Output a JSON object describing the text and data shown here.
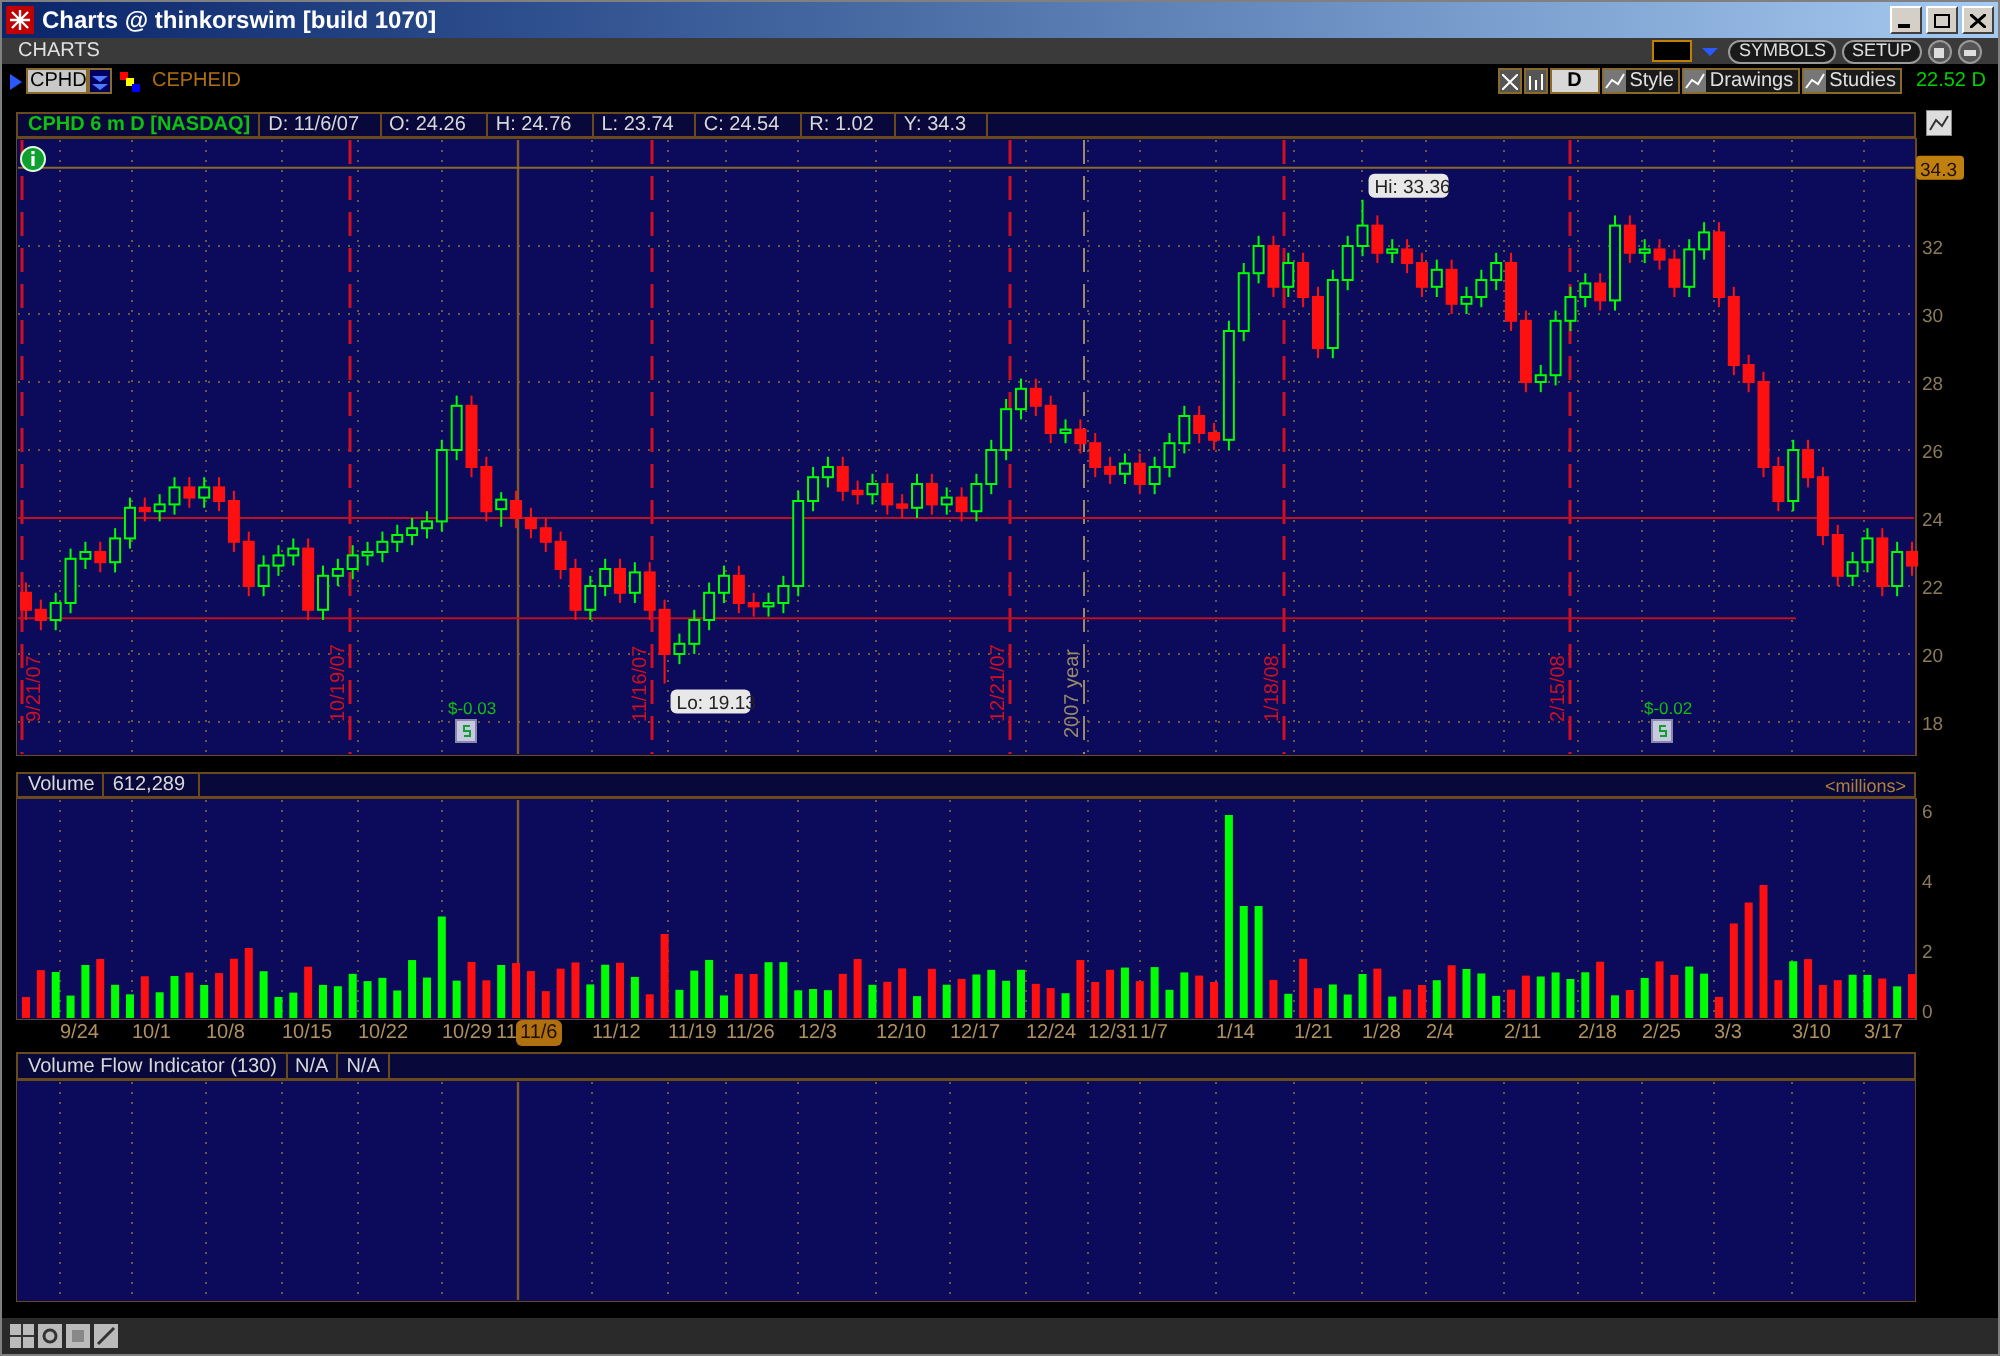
{
  "window": {
    "title": "Charts @ thinkorswim [build 1070]"
  },
  "section": {
    "title": "CHARTS"
  },
  "header_buttons": [
    "SYMBOLS",
    "SETUP"
  ],
  "symbol_bar": {
    "symbol": "CPHD",
    "company": "CEPHEID"
  },
  "chart_toolbar": {
    "aggregation": "D",
    "buttons": [
      "Style",
      "Drawings",
      "Studies"
    ],
    "last_price": "22.52 D"
  },
  "price_panel": {
    "title": "CPHD 6 m D [NASDAQ]",
    "fields": [
      "D: 11/6/07",
      "O: 24.26",
      "H: 24.76",
      "L: 23.74",
      "C: 24.54",
      "R: 1.02",
      "Y: 34.3"
    ],
    "price_marker": "34.3",
    "high_label": "Hi: 33.36",
    "low_label": "Lo: 19.13",
    "date_markers": [
      {
        "label": "9/21/07",
        "kind": "month"
      },
      {
        "label": "10/19/07",
        "kind": "month"
      },
      {
        "label": "11/16/07",
        "kind": "month"
      },
      {
        "label": "12/21/07",
        "kind": "month"
      },
      {
        "label": "2007 year",
        "kind": "year"
      },
      {
        "label": "1/18/08",
        "kind": "month"
      },
      {
        "label": "2/15/08",
        "kind": "month"
      }
    ],
    "dividends": [
      "$-0.03",
      "$-0.02"
    ],
    "chart_data": {
      "type": "candlestick",
      "grid": true,
      "ylim": [
        17,
        35
      ],
      "yticks": [
        32,
        30,
        28,
        26,
        24,
        22,
        20,
        18
      ],
      "ref_lines": [
        {
          "axis": "y",
          "value": 34.3,
          "color": "#8a6a2a"
        },
        {
          "axis": "y",
          "value": 24,
          "color": "#c01020"
        },
        {
          "axis": "y",
          "value": 21.05,
          "color": "#c01020"
        }
      ],
      "ohlc": [
        [
          21.8,
          22.1,
          21.0,
          21.3
        ],
        [
          21.3,
          21.6,
          20.7,
          21.0
        ],
        [
          21.0,
          21.8,
          20.7,
          21.5
        ],
        [
          21.5,
          23.1,
          21.2,
          22.8
        ],
        [
          22.8,
          23.3,
          22.5,
          23.0
        ],
        [
          23.0,
          23.3,
          22.4,
          22.7
        ],
        [
          22.7,
          23.7,
          22.4,
          23.4
        ],
        [
          23.4,
          24.6,
          23.1,
          24.3
        ],
        [
          24.3,
          24.6,
          23.9,
          24.2
        ],
        [
          24.2,
          24.7,
          23.9,
          24.4
        ],
        [
          24.4,
          25.2,
          24.1,
          24.9
        ],
        [
          24.9,
          25.2,
          24.3,
          24.6
        ],
        [
          24.6,
          25.2,
          24.3,
          24.9
        ],
        [
          24.9,
          25.2,
          24.2,
          24.5
        ],
        [
          24.5,
          24.8,
          23.0,
          23.3
        ],
        [
          23.3,
          23.6,
          21.7,
          22.0
        ],
        [
          22.0,
          22.9,
          21.7,
          22.6
        ],
        [
          22.6,
          23.2,
          22.3,
          22.9
        ],
        [
          22.9,
          23.4,
          22.6,
          23.1
        ],
        [
          23.1,
          23.4,
          21.0,
          21.3
        ],
        [
          21.3,
          22.6,
          21.0,
          22.3
        ],
        [
          22.3,
          22.8,
          22.0,
          22.5
        ],
        [
          22.5,
          23.2,
          22.2,
          22.9
        ],
        [
          22.9,
          23.3,
          22.6,
          23.0
        ],
        [
          23.0,
          23.6,
          22.7,
          23.3
        ],
        [
          23.3,
          23.8,
          23.0,
          23.5
        ],
        [
          23.5,
          24.0,
          23.2,
          23.7
        ],
        [
          23.7,
          24.2,
          23.4,
          23.9
        ],
        [
          23.9,
          26.3,
          23.6,
          26.0
        ],
        [
          26.0,
          27.6,
          25.7,
          27.3
        ],
        [
          27.3,
          27.6,
          25.2,
          25.5
        ],
        [
          25.5,
          25.8,
          23.9,
          24.2
        ],
        [
          24.26,
          24.76,
          23.74,
          24.54
        ],
        [
          24.5,
          24.8,
          23.7,
          24.0
        ],
        [
          24.0,
          24.3,
          23.4,
          23.7
        ],
        [
          23.7,
          24.0,
          23.0,
          23.3
        ],
        [
          23.3,
          23.6,
          22.2,
          22.5
        ],
        [
          22.5,
          22.8,
          21.0,
          21.3
        ],
        [
          21.3,
          22.3,
          21.0,
          22.0
        ],
        [
          22.0,
          22.8,
          21.7,
          22.5
        ],
        [
          22.5,
          22.8,
          21.5,
          21.8
        ],
        [
          21.8,
          22.7,
          21.5,
          22.4
        ],
        [
          22.4,
          22.7,
          21.0,
          21.3
        ],
        [
          21.3,
          21.6,
          19.13,
          20.0
        ],
        [
          20.0,
          20.6,
          19.7,
          20.3
        ],
        [
          20.3,
          21.3,
          20.0,
          21.0
        ],
        [
          21.0,
          22.1,
          20.7,
          21.8
        ],
        [
          21.8,
          22.6,
          21.5,
          22.3
        ],
        [
          22.3,
          22.6,
          21.2,
          21.5
        ],
        [
          21.5,
          21.8,
          21.1,
          21.4
        ],
        [
          21.4,
          21.8,
          21.1,
          21.5
        ],
        [
          21.5,
          22.3,
          21.2,
          22.0
        ],
        [
          22.0,
          24.8,
          21.7,
          24.5
        ],
        [
          24.5,
          25.5,
          24.2,
          25.2
        ],
        [
          25.2,
          25.8,
          24.9,
          25.5
        ],
        [
          25.5,
          25.8,
          24.5,
          24.8
        ],
        [
          24.8,
          25.1,
          24.4,
          24.7
        ],
        [
          24.7,
          25.3,
          24.4,
          25.0
        ],
        [
          25.0,
          25.3,
          24.1,
          24.4
        ],
        [
          24.4,
          24.7,
          24.0,
          24.3
        ],
        [
          24.3,
          25.3,
          24.0,
          25.0
        ],
        [
          25.0,
          25.3,
          24.1,
          24.4
        ],
        [
          24.4,
          24.9,
          24.1,
          24.6
        ],
        [
          24.6,
          24.9,
          23.9,
          24.2
        ],
        [
          24.2,
          25.3,
          23.9,
          25.0
        ],
        [
          25.0,
          26.3,
          24.7,
          26.0
        ],
        [
          26.0,
          27.5,
          25.7,
          27.2
        ],
        [
          27.2,
          28.1,
          26.9,
          27.8
        ],
        [
          27.8,
          28.1,
          27.0,
          27.3
        ],
        [
          27.3,
          27.6,
          26.2,
          26.5
        ],
        [
          26.5,
          26.9,
          26.2,
          26.6
        ],
        [
          26.6,
          26.9,
          25.9,
          26.2
        ],
        [
          26.2,
          26.5,
          25.2,
          25.5
        ],
        [
          25.5,
          25.8,
          25.0,
          25.3
        ],
        [
          25.3,
          25.9,
          25.0,
          25.6
        ],
        [
          25.6,
          25.9,
          24.7,
          25.0
        ],
        [
          25.0,
          25.8,
          24.7,
          25.5
        ],
        [
          25.5,
          26.5,
          25.2,
          26.2
        ],
        [
          26.2,
          27.3,
          25.9,
          27.0
        ],
        [
          27.0,
          27.3,
          26.2,
          26.5
        ],
        [
          26.5,
          26.8,
          26.0,
          26.3
        ],
        [
          26.3,
          29.8,
          26.0,
          29.5
        ],
        [
          29.5,
          31.5,
          29.2,
          31.2
        ],
        [
          31.2,
          32.3,
          30.9,
          32.0
        ],
        [
          32.0,
          32.3,
          30.5,
          30.8
        ],
        [
          30.8,
          31.8,
          30.5,
          31.5
        ],
        [
          31.5,
          31.8,
          30.2,
          30.5
        ],
        [
          30.5,
          30.8,
          28.7,
          29.0
        ],
        [
          29.0,
          31.3,
          28.7,
          31.0
        ],
        [
          31.0,
          32.3,
          30.7,
          32.0
        ],
        [
          32.0,
          33.36,
          31.7,
          32.6
        ],
        [
          32.6,
          32.9,
          31.5,
          31.8
        ],
        [
          31.8,
          32.2,
          31.5,
          31.9
        ],
        [
          31.9,
          32.2,
          31.2,
          31.5
        ],
        [
          31.5,
          31.8,
          30.5,
          30.8
        ],
        [
          30.8,
          31.6,
          30.5,
          31.3
        ],
        [
          31.3,
          31.6,
          30.0,
          30.3
        ],
        [
          30.3,
          30.8,
          30.0,
          30.5
        ],
        [
          30.5,
          31.3,
          30.2,
          31.0
        ],
        [
          31.0,
          31.8,
          30.7,
          31.5
        ],
        [
          31.5,
          31.8,
          29.5,
          29.8
        ],
        [
          29.8,
          30.1,
          27.7,
          28.0
        ],
        [
          28.0,
          28.5,
          27.7,
          28.2
        ],
        [
          28.2,
          30.1,
          27.9,
          29.8
        ],
        [
          29.8,
          30.8,
          29.5,
          30.5
        ],
        [
          30.5,
          31.2,
          30.2,
          30.9
        ],
        [
          30.9,
          31.2,
          30.1,
          30.4
        ],
        [
          30.4,
          32.9,
          30.1,
          32.6
        ],
        [
          32.6,
          32.9,
          31.5,
          31.8
        ],
        [
          31.8,
          32.2,
          31.5,
          31.9
        ],
        [
          31.9,
          32.2,
          31.3,
          31.6
        ],
        [
          31.6,
          31.9,
          30.5,
          30.8
        ],
        [
          30.8,
          32.2,
          30.5,
          31.9
        ],
        [
          31.9,
          32.7,
          31.6,
          32.4
        ],
        [
          32.4,
          32.7,
          30.2,
          30.5
        ],
        [
          30.5,
          30.8,
          28.2,
          28.5
        ],
        [
          28.5,
          28.8,
          27.7,
          28.0
        ],
        [
          28.0,
          28.3,
          25.2,
          25.5
        ],
        [
          25.5,
          25.8,
          24.2,
          24.5
        ],
        [
          24.5,
          26.3,
          24.2,
          26.0
        ],
        [
          26.0,
          26.3,
          24.9,
          25.2
        ],
        [
          25.2,
          25.5,
          23.2,
          23.5
        ],
        [
          23.5,
          23.8,
          22.0,
          22.3
        ],
        [
          22.3,
          23.0,
          22.0,
          22.7
        ],
        [
          22.7,
          23.7,
          22.4,
          23.4
        ],
        [
          23.4,
          23.7,
          21.7,
          22.0
        ],
        [
          22.0,
          23.3,
          21.7,
          23.0
        ],
        [
          23.0,
          23.3,
          22.3,
          22.6
        ]
      ]
    }
  },
  "volume_panel": {
    "title": "Volume",
    "value": "612,289",
    "unit": "<millions>",
    "yticks": [
      "6",
      "4",
      "2",
      "0"
    ]
  },
  "x_axis": {
    "labels": [
      "9/24",
      "10/1",
      "10/8",
      "10/15",
      "10/22",
      "10/29",
      "11",
      "11/12",
      "11/19",
      "11/26",
      "12/3",
      "12/10",
      "12/17",
      "12/24",
      "12/31",
      "1/7",
      "1/14",
      "1/21",
      "1/28",
      "2/4",
      "2/11",
      "2/18",
      "2/25",
      "3/3",
      "3/10",
      "3/17"
    ],
    "cursor_date": "11/6"
  },
  "study_panel": {
    "title": "Volume Flow Indicator (130)",
    "values": [
      "N/A",
      "N/A"
    ]
  }
}
